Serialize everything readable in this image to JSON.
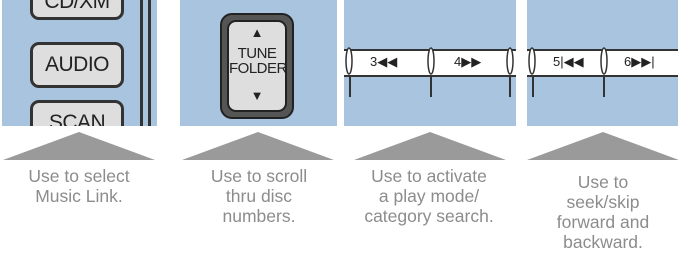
{
  "panel1": {
    "buttons": [
      "CD/XM",
      "AUDIO",
      "SCAN"
    ]
  },
  "panel2": {
    "knob_label_line1": "TUNE",
    "knob_label_line2": "FOLDER",
    "up_arrow": "▲",
    "down_arrow": "▼"
  },
  "panel3": {
    "labels": [
      "3◀◀",
      "4▶▶"
    ]
  },
  "panel4": {
    "labels": [
      "5|◀◀",
      "6▶▶|"
    ]
  },
  "captions": [
    "Use to select\nMusic Link.",
    "Use to scroll\nthru disc\nnumbers.",
    "Use to activate\na play mode/\ncategory search.",
    "Use to\nseek/skip\nforward and\nbackward."
  ],
  "colors": {
    "panel_bg": "#a8c4de",
    "caption": "#8c8c8c",
    "triangle": "#9a9a9a"
  }
}
